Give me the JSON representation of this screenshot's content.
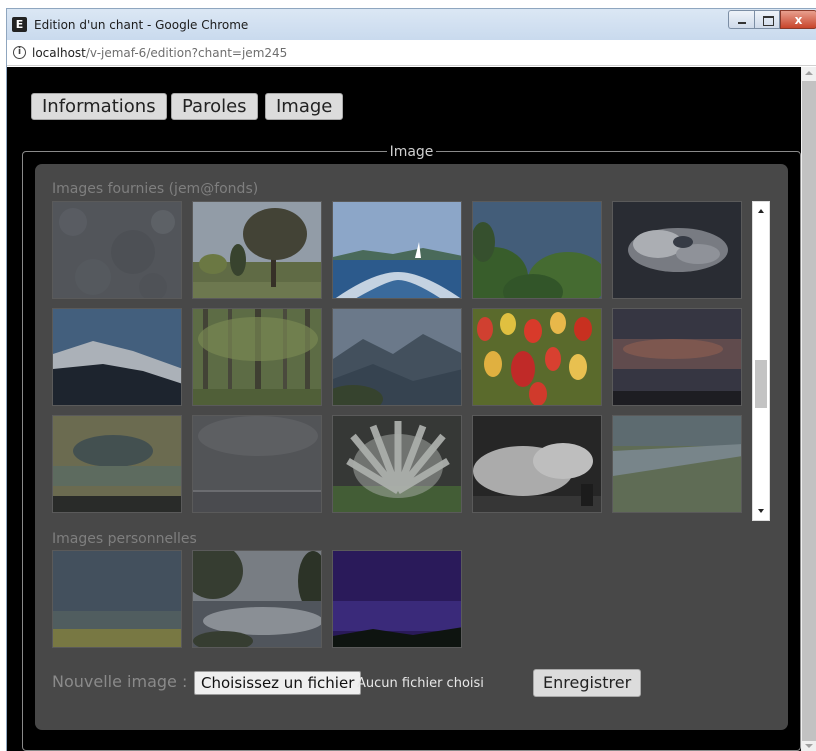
{
  "window": {
    "title": "Edition d'un chant - Google Chrome",
    "app_icon_letter": "E",
    "close_glyph": "x"
  },
  "address_bar": {
    "host": "localhost",
    "path": "/v-jemaf-6/edition?chant=jem245"
  },
  "tabs": [
    {
      "label": "Informations"
    },
    {
      "label": "Paroles"
    },
    {
      "label": "Image"
    }
  ],
  "fieldset": {
    "legend": "Image"
  },
  "provided_images": {
    "title": "Images fournies (jem@fonds)",
    "items": [
      {
        "name": "texture-grise"
      },
      {
        "name": "arbre-prairie"
      },
      {
        "name": "lac-voilier"
      },
      {
        "name": "arbres-ciel"
      },
      {
        "name": "nuages-sombres"
      },
      {
        "name": "montagne-neige"
      },
      {
        "name": "foret-verte"
      },
      {
        "name": "vallee-montagne"
      },
      {
        "name": "tulipes"
      },
      {
        "name": "coucher-soleil"
      },
      {
        "name": "nuages-ocre"
      },
      {
        "name": "brume-grise"
      },
      {
        "name": "paon-blanc"
      },
      {
        "name": "vagues-noir-blanc"
      },
      {
        "name": "riviere-plaine"
      }
    ]
  },
  "personal_images": {
    "title": "Images personnelles",
    "items": [
      {
        "name": "champ-brume"
      },
      {
        "name": "lac-reflet"
      },
      {
        "name": "ciel-nuit"
      }
    ]
  },
  "upload": {
    "label": "Nouvelle image :",
    "file_button": "Choisissez un fichier",
    "file_status": "Aucun fichier choisi",
    "save_button": "Enregistrer"
  }
}
